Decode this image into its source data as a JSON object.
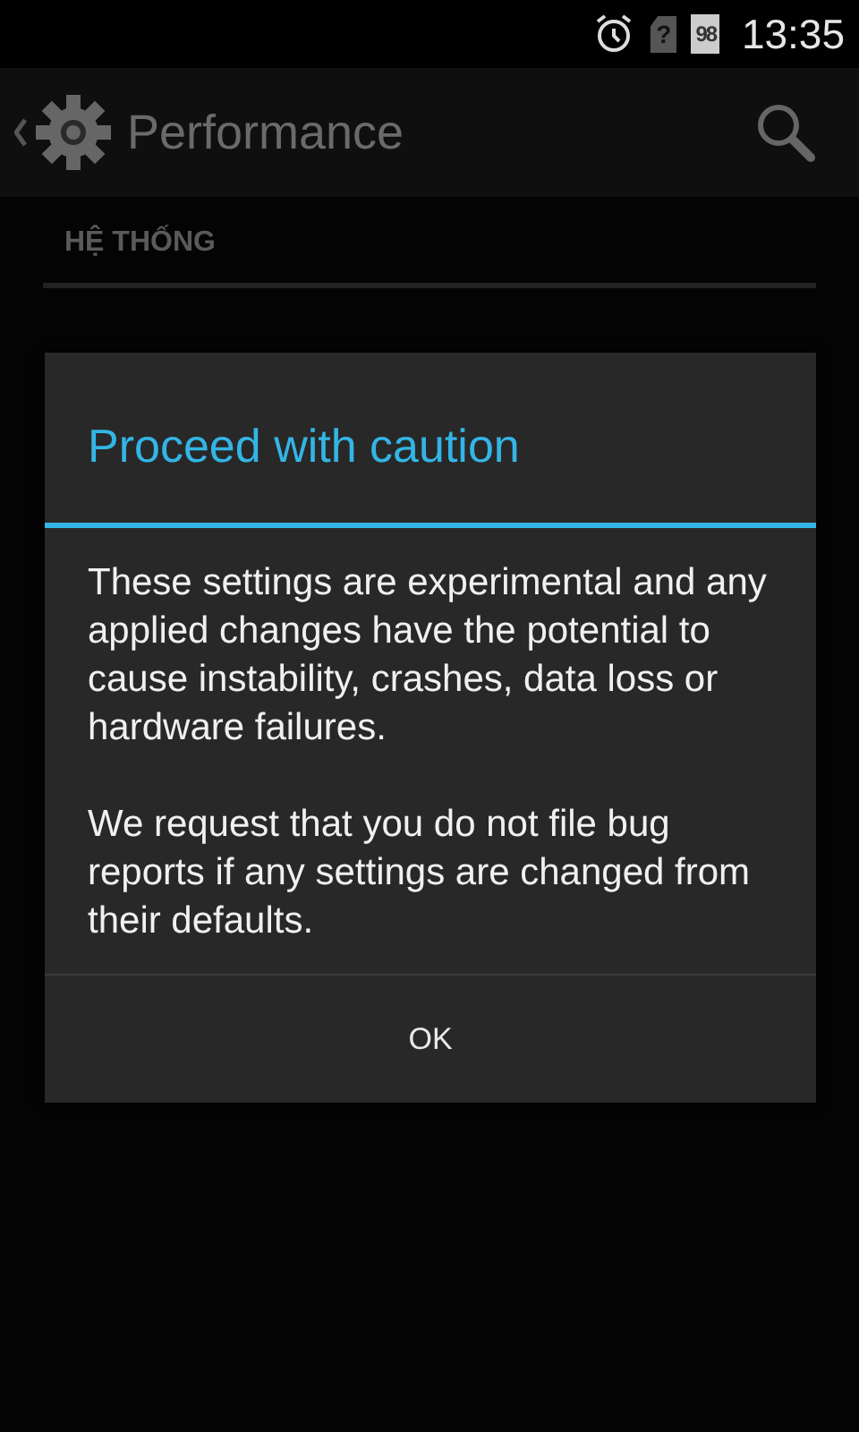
{
  "status_bar": {
    "sim_icon_text": "?",
    "battery": "98",
    "time": "13:35"
  },
  "action_bar": {
    "title": "Performance"
  },
  "section_header": "HỆ THỐNG",
  "dialog": {
    "title": "Proceed with caution",
    "paragraphs": [
      "These settings are experimental and any applied changes have the potential to cause instability, crashes, data loss or hardware failures.",
      "We request that you do not file bug reports if any settings are changed from their defaults."
    ],
    "buttons": [
      "OK"
    ]
  }
}
